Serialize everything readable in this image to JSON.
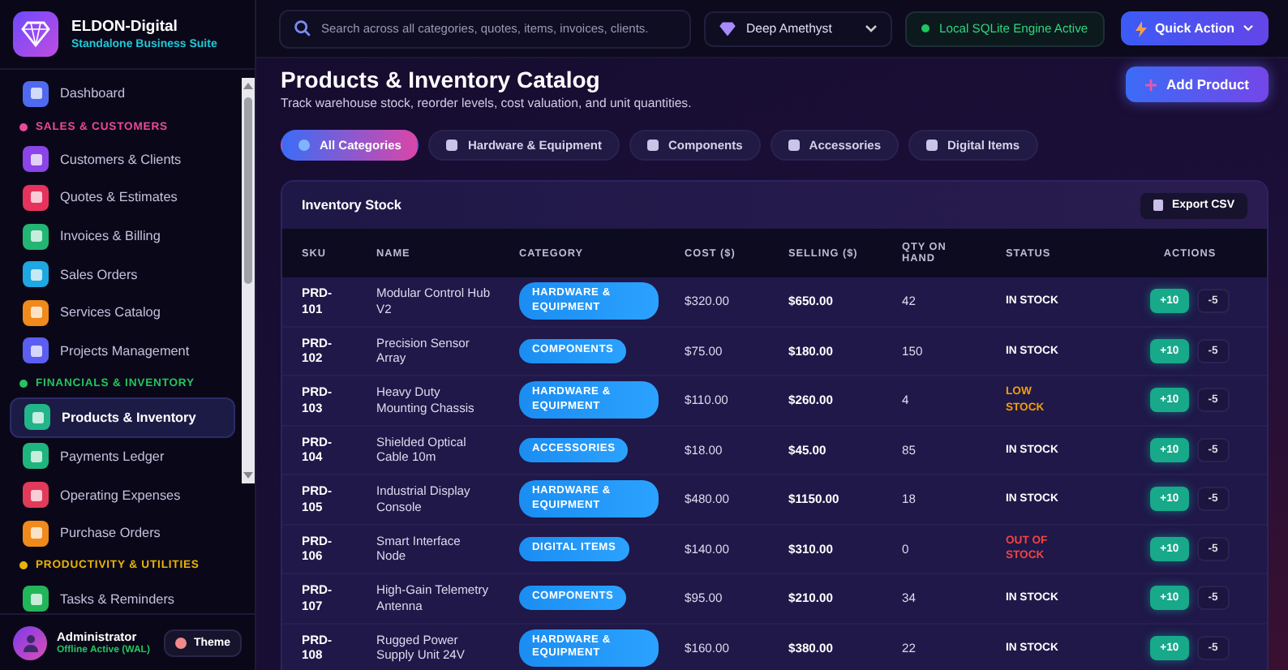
{
  "brand": {
    "name": "ELDON-Digital",
    "tagline": "Standalone Business Suite"
  },
  "sidebar": {
    "items": [
      {
        "kind": "item",
        "label": "Dashboard",
        "color": "#4f6af0",
        "selected": false
      },
      {
        "kind": "section",
        "label": "SALES & CUSTOMERS",
        "color": "#ec4899"
      },
      {
        "kind": "item",
        "label": "Customers & Clients",
        "color": "#8b44e8",
        "selected": false
      },
      {
        "kind": "item",
        "label": "Quotes & Estimates",
        "color": "#e6335e",
        "selected": false
      },
      {
        "kind": "item",
        "label": "Invoices & Billing",
        "color": "#22b573",
        "selected": false
      },
      {
        "kind": "item",
        "label": "Sales Orders",
        "color": "#1ea7e0",
        "selected": false
      },
      {
        "kind": "item",
        "label": "Services Catalog",
        "color": "#f08a1c",
        "selected": false
      },
      {
        "kind": "item",
        "label": "Projects Management",
        "color": "#5b5ef0",
        "selected": false
      },
      {
        "kind": "section",
        "label": "FINANCIALS & INVENTORY",
        "color": "#22c55e"
      },
      {
        "kind": "item",
        "label": "Products & Inventory",
        "color": "#22b58a",
        "selected": true
      },
      {
        "kind": "item",
        "label": "Payments Ledger",
        "color": "#1fb57e",
        "selected": false
      },
      {
        "kind": "item",
        "label": "Operating Expenses",
        "color": "#e23a5a",
        "selected": false
      },
      {
        "kind": "item",
        "label": "Purchase Orders",
        "color": "#f08a1c",
        "selected": false
      },
      {
        "kind": "section",
        "label": "PRODUCTIVITY & UTILITIES",
        "color": "#eab308"
      },
      {
        "kind": "item",
        "label": "Tasks & Reminders",
        "color": "#22b55a",
        "selected": false
      }
    ]
  },
  "user": {
    "name": "Administrator",
    "status": "Offline Active (WAL)",
    "theme_button": "Theme"
  },
  "topbar": {
    "search": {
      "placeholder": "Search across all categories, quotes, items, invoices, clients."
    },
    "theme_select": "Deep Amethyst",
    "engine_status": "Local SQLite Engine Active",
    "quick_action": "Quick Action"
  },
  "page": {
    "title": "Products & Inventory Catalog",
    "subtitle": "Track warehouse stock, reorder levels, cost valuation, and unit quantities.",
    "add_button": "Add Product"
  },
  "filters": [
    {
      "label": "All Categories",
      "selected": true
    },
    {
      "label": "Hardware & Equipment",
      "selected": false
    },
    {
      "label": "Components",
      "selected": false
    },
    {
      "label": "Accessories",
      "selected": false
    },
    {
      "label": "Digital Items",
      "selected": false
    }
  ],
  "table": {
    "title": "Inventory Stock",
    "export_button": "Export CSV",
    "columns": [
      "SKU",
      "NAME",
      "CATEGORY",
      "COST ($)",
      "SELLING ($)",
      "QTY ON HAND",
      "STATUS",
      "ACTIONS"
    ],
    "rows": [
      {
        "sku": "PRD-101",
        "name": "Modular Control Hub V2",
        "category": "HARDWARE & EQUIPMENT",
        "cost": "$320.00",
        "selling": "$650.00",
        "qty": "42",
        "status": "IN STOCK",
        "kind": "in_stock",
        "add": "+10",
        "remove": "-5"
      },
      {
        "sku": "PRD-102",
        "name": "Precision Sensor Array",
        "category": "COMPONENTS",
        "cost": "$75.00",
        "selling": "$180.00",
        "qty": "150",
        "status": "IN STOCK",
        "kind": "in_stock",
        "add": "+10",
        "remove": "-5"
      },
      {
        "sku": "PRD-103",
        "name": "Heavy Duty Mounting Chassis",
        "category": "HARDWARE & EQUIPMENT",
        "cost": "$110.00",
        "selling": "$260.00",
        "qty": "4",
        "status": "LOW STOCK",
        "kind": "low_stock",
        "add": "+10",
        "remove": "-5"
      },
      {
        "sku": "PRD-104",
        "name": "Shielded Optical Cable 10m",
        "category": "ACCESSORIES",
        "cost": "$18.00",
        "selling": "$45.00",
        "qty": "85",
        "status": "IN STOCK",
        "kind": "in_stock",
        "add": "+10",
        "remove": "-5"
      },
      {
        "sku": "PRD-105",
        "name": "Industrial Display Console",
        "category": "HARDWARE & EQUIPMENT",
        "cost": "$480.00",
        "selling": "$1150.00",
        "qty": "18",
        "status": "IN STOCK",
        "kind": "in_stock",
        "add": "+10",
        "remove": "-5"
      },
      {
        "sku": "PRD-106",
        "name": "Smart Interface Node",
        "category": "DIGITAL ITEMS",
        "cost": "$140.00",
        "selling": "$310.00",
        "qty": "0",
        "status": "OUT OF STOCK",
        "kind": "out_of_stock",
        "add": "+10",
        "remove": "-5"
      },
      {
        "sku": "PRD-107",
        "name": "High-Gain Telemetry Antenna",
        "category": "COMPONENTS",
        "cost": "$95.00",
        "selling": "$210.00",
        "qty": "34",
        "status": "IN STOCK",
        "kind": "in_stock",
        "add": "+10",
        "remove": "-5"
      },
      {
        "sku": "PRD-108",
        "name": "Rugged Power Supply Unit 24V",
        "category": "HARDWARE & EQUIPMENT",
        "cost": "$160.00",
        "selling": "$380.00",
        "qty": "22",
        "status": "IN STOCK",
        "kind": "in_stock",
        "add": "+10",
        "remove": "-5"
      }
    ]
  }
}
